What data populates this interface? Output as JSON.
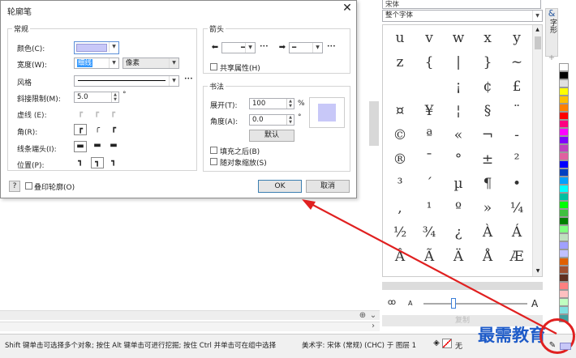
{
  "dialog": {
    "title": "轮廓笔",
    "general_title": "常规",
    "color_label": "颜色(C):",
    "width_label": "宽度(W):",
    "width_value": "细线",
    "unit_value": "像素",
    "style_label": "风格",
    "miter_label": "斜接限制(M):",
    "miter_value": "5.0",
    "degree": "°",
    "dash_label": "虚线 (E):",
    "corner_label": "角(R):",
    "linecap_label": "线条端头(I):",
    "position_label": "位置(P):",
    "arrow_title": "箭头",
    "share_attr_label": "共享属性(H)",
    "calligraphy_title": "书法",
    "stretch_label": "展开(T):",
    "stretch_value": "100",
    "percent": "%",
    "angle_label": "角度(A):",
    "angle_value": "0.0",
    "default_button": "默认",
    "fill_behind_label": "填充之后(B)",
    "scale_with_label": "随对象缩放(S)",
    "help_button": "?",
    "overprint_label": "叠印轮廓(O)",
    "ok_button": "OK",
    "cancel_button": "取消",
    "ellipsis": "•••",
    "accent_color": "#c8c8f8"
  },
  "docker": {
    "font_name_partial": "宋体",
    "char_filter": "整个字体",
    "tab_label": "字形",
    "glyphs": [
      "u",
      "v",
      "w",
      "x",
      "y",
      "z",
      "{",
      "|",
      "}",
      "~",
      "",
      "",
      "¡",
      "¢",
      "£",
      "¤",
      "¥",
      "¦",
      "§",
      "¨",
      "©",
      "ª",
      "«",
      "¬",
      "-",
      "®",
      "¯",
      "°",
      "±",
      "²",
      "³",
      "´",
      "µ",
      "¶",
      "•",
      ",",
      "¹",
      "º",
      "»",
      "¼",
      "½",
      "¾",
      "¿",
      "À",
      "Á",
      "Â",
      "Ã",
      "Ä",
      "Å",
      "Æ"
    ],
    "zoom_small_label": "A",
    "zoom_large_label": "A",
    "copy_button": "复制"
  },
  "status": {
    "hint": "Shift 键单击可选择多个对象; 按住 Alt 键单击可进行挖掘; 按住 Ctrl 并单击可在组中选择",
    "object_info": "美术字: 宋体 (常规) (CHC) 于 图层 1",
    "fill_none": "无"
  },
  "watermark": "最需教育",
  "palette": [
    "#ffffff",
    "#000000",
    "#e0e0e0",
    "#ffff00",
    "#ffc000",
    "#ff8000",
    "#ff0000",
    "#ff0080",
    "#ff00ff",
    "#8000ff",
    "#c040c0",
    "#e060a0",
    "#0000ff",
    "#0040c0",
    "#00a0ff",
    "#00ffff",
    "#00c0a0",
    "#00ff00",
    "#40c040",
    "#008000",
    "#80ff80",
    "#c0e0c0",
    "#a0a0ff",
    "#c0c0ff",
    "#e06000",
    "#a05030",
    "#603020",
    "#ff8080",
    "#ffc0c0",
    "#c0ffc0",
    "#80e0e0",
    "#40a0a0"
  ]
}
